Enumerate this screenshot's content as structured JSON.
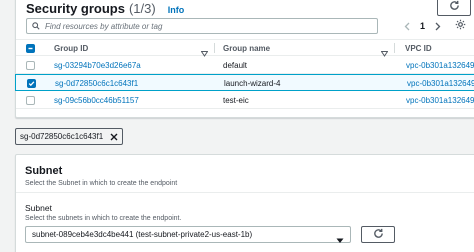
{
  "security_groups": {
    "title": "Security groups",
    "count": "(1/3)",
    "info_label": "Info",
    "search_placeholder": "Find resources by attribute or tag",
    "current_page": "1",
    "columns": {
      "group_id": "Group ID",
      "group_name": "Group name",
      "vpc_id": "VPC ID"
    },
    "rows": [
      {
        "group_id": "sg-03294b70e3d26e67a",
        "group_name": "default",
        "vpc_id": "vpc-0b301a1326494",
        "selected": false
      },
      {
        "group_id": "sg-0d72850c6c1c643f1",
        "group_name": "launch-wizard-4",
        "vpc_id": "vpc-0b301a1326494",
        "selected": true
      },
      {
        "group_id": "sg-09c56b0cc46b51157",
        "group_name": "test-eic",
        "vpc_id": "vpc-0b301a1326494",
        "selected": false
      }
    ]
  },
  "selected_token": {
    "label": "sg-0d72850c6c1c643f1"
  },
  "subnet": {
    "title": "Subnet",
    "description": "Select the Subnet in which to create the endpoint",
    "field_label": "Subnet",
    "field_description": "Select the subnets in which to create the endpoint.",
    "selected_value": "subnet-089ceb4e3dc4be441 (test-subnet-private2-us-east-1b)"
  },
  "colors": {
    "link": "#0073bb",
    "selected_row_bg": "#f1faff",
    "selected_row_border": "#00a1c9",
    "checkbox_checked": "#0073bb"
  },
  "icons": [
    "refresh-icon",
    "search-icon",
    "chevron-left-icon",
    "chevron-right-icon",
    "gear-icon",
    "sort-caret-icon",
    "close-icon",
    "caret-down-icon"
  ]
}
